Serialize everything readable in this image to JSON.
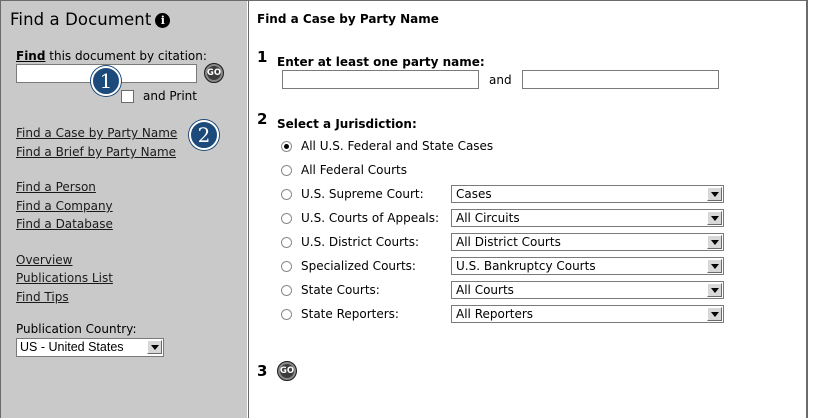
{
  "sidebar": {
    "title": "Find a Document",
    "info_icon": "info-icon",
    "cite_label_bold": "Find",
    "cite_label_rest": " this document by citation:",
    "cite_value": "",
    "go_label": "GO",
    "print_label": "and Print",
    "print_checked": false,
    "links": [
      "Find a Case by Party Name",
      "Find a Brief by Party Name",
      "Find a Person",
      "Find a Company",
      "Find a Database",
      "Overview",
      "Publications List",
      "Find Tips"
    ],
    "country_label": "Publication Country:",
    "country_value": "US - United States"
  },
  "callouts": [
    "1",
    "2"
  ],
  "main": {
    "title": "Find a Case by Party Name",
    "step1": {
      "number": "1",
      "label": "Enter at least one party name:",
      "and_text": "and",
      "party1": "",
      "party2": ""
    },
    "step2": {
      "number": "2",
      "label": "Select a Jurisdiction:",
      "options": [
        {
          "label": "All U.S. Federal and State Cases",
          "checked": true,
          "select": null
        },
        {
          "label": "All Federal Courts",
          "checked": false,
          "select": null
        },
        {
          "label": "U.S. Supreme Court:",
          "checked": false,
          "select": "Cases"
        },
        {
          "label": "U.S. Courts of Appeals:",
          "checked": false,
          "select": "All Circuits"
        },
        {
          "label": "U.S. District Courts:",
          "checked": false,
          "select": "All District Courts"
        },
        {
          "label": "Specialized Courts:",
          "checked": false,
          "select": "U.S. Bankruptcy Courts"
        },
        {
          "label": "State Courts:",
          "checked": false,
          "select": "All Courts"
        },
        {
          "label": "State Reporters:",
          "checked": false,
          "select": "All Reporters"
        }
      ]
    },
    "step3": {
      "number": "3",
      "go_label": "GO"
    }
  },
  "colors": {
    "sidebar_bg": "#c9c9c9",
    "callout_bg": "#1c4a7a",
    "border": "#6b6b6b"
  }
}
